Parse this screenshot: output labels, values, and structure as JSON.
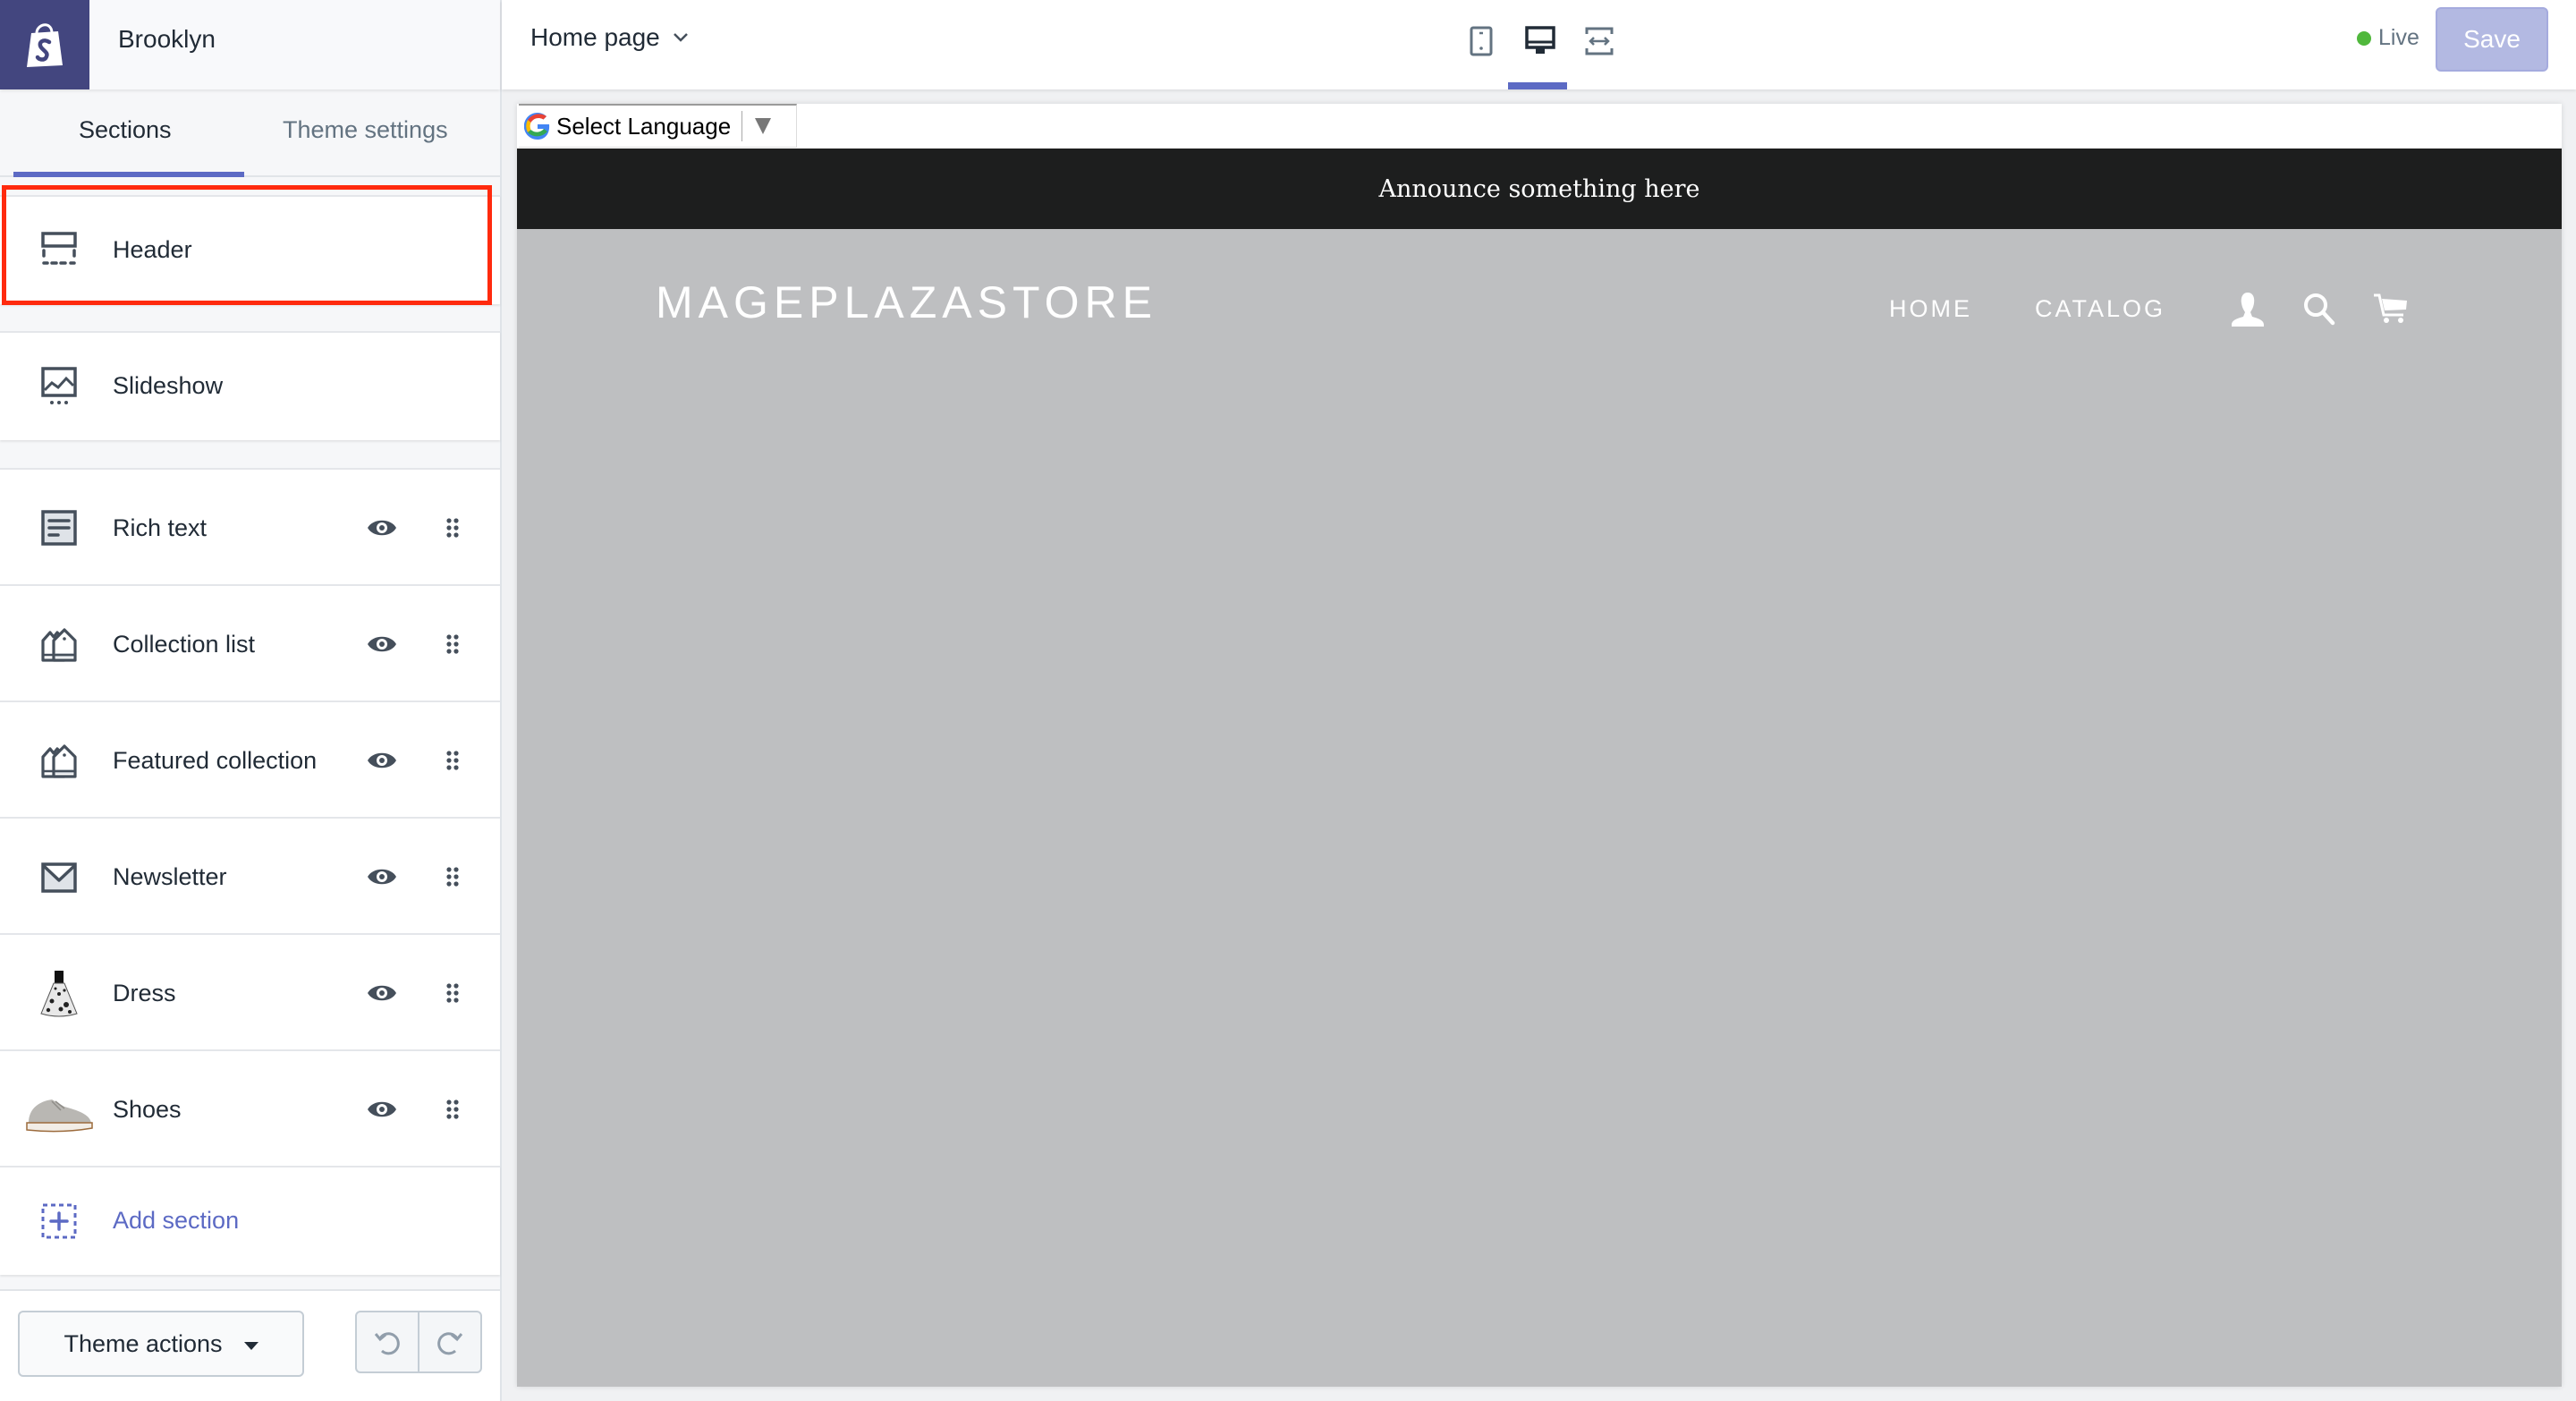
{
  "brand": {
    "store_name": "Brooklyn",
    "logo_icon": "shopify-bag-icon"
  },
  "tabs": [
    {
      "label": "Sections",
      "active": true
    },
    {
      "label": "Theme settings",
      "active": false
    }
  ],
  "sections": {
    "fixed": [
      {
        "label": "Header",
        "icon": "header-layout-icon",
        "highlighted": true
      },
      {
        "label": "Slideshow",
        "icon": "slideshow-icon"
      }
    ],
    "content": [
      {
        "label": "Rich text",
        "icon": "rich-text-icon"
      },
      {
        "label": "Collection list",
        "icon": "collection-icon"
      },
      {
        "label": "Featured collection",
        "icon": "collection-icon"
      },
      {
        "label": "Newsletter",
        "icon": "envelope-icon"
      },
      {
        "label": "Dress",
        "icon": "dress-thumbnail"
      },
      {
        "label": "Shoes",
        "icon": "shoes-thumbnail"
      }
    ],
    "add_section_label": "Add section"
  },
  "footer": {
    "theme_actions_label": "Theme actions",
    "undo_icon": "undo-icon",
    "redo_icon": "redo-icon"
  },
  "topbar": {
    "page_selector": "Home page",
    "devices": [
      {
        "name": "mobile",
        "active": false
      },
      {
        "name": "desktop",
        "active": true
      },
      {
        "name": "fullscreen",
        "active": false
      }
    ],
    "status": "Live",
    "save_label": "Save"
  },
  "colors": {
    "accent": "#5c6ac4",
    "brand": "#43467f",
    "live": "#50b83c",
    "save_disabled": "#b3b9e2",
    "highlight": "#ff2a0e"
  },
  "preview": {
    "translate_label": "Select Language",
    "announcement": "Announce something here",
    "store_logo": "MAGEPLAZASTORE",
    "nav": [
      "HOME",
      "CATALOG"
    ]
  }
}
